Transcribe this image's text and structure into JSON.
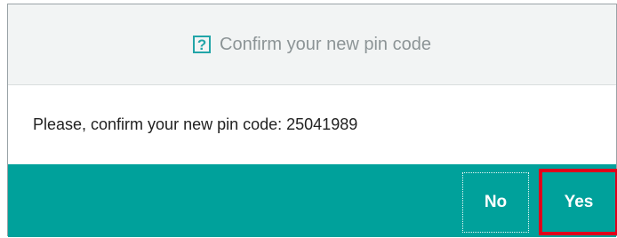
{
  "dialog": {
    "title": "Confirm your new pin code",
    "icon": "help-icon",
    "message": "Please, confirm your new pin code: 25041989",
    "buttons": {
      "no_label": "No",
      "yes_label": "Yes"
    },
    "colors": {
      "footer": "#00a19b",
      "accent": "#22a5a8",
      "highlight": "#e0001b"
    }
  }
}
